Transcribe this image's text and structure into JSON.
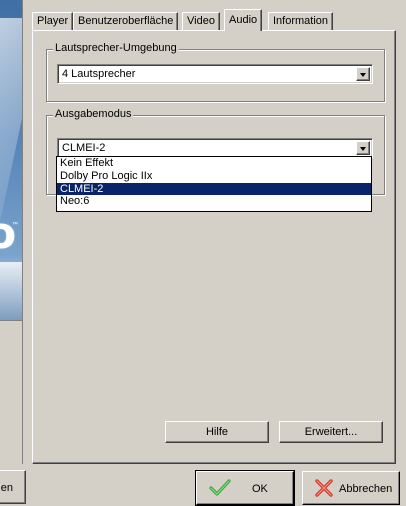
{
  "tabs": [
    {
      "label": "Player",
      "active": false
    },
    {
      "label": "Benutzeroberfläche",
      "active": false
    },
    {
      "label": "Video",
      "active": false
    },
    {
      "label": "Audio",
      "active": true
    },
    {
      "label": "Information",
      "active": false
    }
  ],
  "speaker_group": {
    "title": "Lautsprecher-Umgebung",
    "value": "4 Lautsprecher"
  },
  "output_group": {
    "title": "Ausgabemodus",
    "value": "CLMEI-2",
    "options": [
      "Kein Effekt",
      "Dolby Pro Logic IIx",
      "CLMEI-2",
      "Neo:6"
    ],
    "selected_option": "CLMEI-2"
  },
  "panel_buttons": {
    "help": "Hilfe",
    "advanced": "Erweitert..."
  },
  "footer": {
    "left_partial": "en",
    "ok": "OK",
    "cancel": "Abbrechen"
  },
  "colors": {
    "face": "#d4d0c8",
    "selection": "#0a246a",
    "ok_icon": "#3aa53a",
    "cancel_icon": "#d23a2a"
  },
  "icons": {
    "ok": "check-icon",
    "cancel": "x-icon",
    "dropdown": "chevron-down-icon"
  }
}
